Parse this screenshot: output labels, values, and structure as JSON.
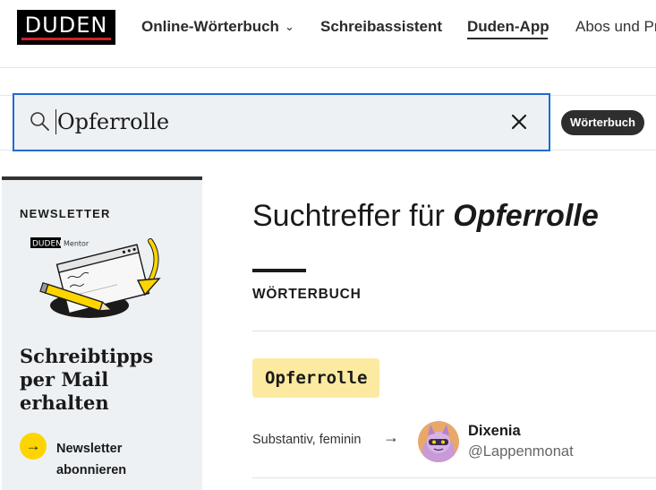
{
  "header": {
    "logo_text": "DUDEN",
    "nav": [
      {
        "label": "Online-Wörterbuch",
        "has_dropdown": true
      },
      {
        "label": "Schreibassistent"
      },
      {
        "label": "Duden-App",
        "active": true
      },
      {
        "label": "Abos und Pr"
      }
    ]
  },
  "search": {
    "value": "Opferrolle",
    "icon": "search-icon",
    "clear_icon": "close-icon",
    "filter_label": "Wörterbuch"
  },
  "newsletter": {
    "kicker": "NEWSLETTER",
    "brand": "DUDEN",
    "brand_suffix": "Mentor",
    "title": "Schreibtipps per Mail erhalten",
    "cta_label": "Newsletter abonnieren",
    "cta_icon": "arrow-right-icon"
  },
  "main": {
    "title_prefix": "Suchtreffer für",
    "title_term": "Opferrolle",
    "section_label": "WÖRTERBUCH",
    "result": {
      "word": "Opferrolle",
      "meta": "Substantiv, feminin",
      "meta_arrow": "→"
    },
    "user": {
      "name": "Dixenia",
      "handle": "@Lappenmonat"
    }
  },
  "colors": {
    "accent_blue": "#1f6bd1",
    "brand_red": "#d3202a",
    "highlight_yellow": "#fbeaa0",
    "cta_yellow": "#ffd500",
    "panel_bg": "#edf1f4"
  }
}
